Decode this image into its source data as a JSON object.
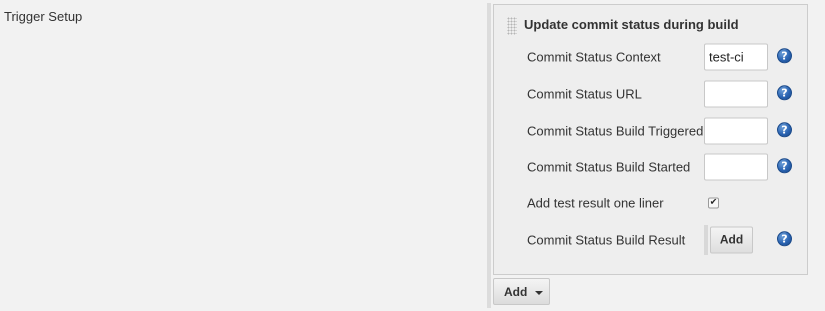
{
  "section": {
    "label": "Trigger Setup"
  },
  "panel": {
    "title": "Update commit status during build",
    "rows": [
      {
        "label": "Commit Status Context",
        "value": "test-ci",
        "help": "?"
      },
      {
        "label": "Commit Status URL",
        "value": "",
        "help": "?"
      },
      {
        "label": "Commit Status Build Triggered",
        "value": "",
        "help": "?"
      },
      {
        "label": "Commit Status Build Started",
        "value": "",
        "help": "?"
      },
      {
        "label": "Add test result one liner",
        "checked": true,
        "check_glyph": "✔"
      },
      {
        "label": "Commit Status Build Result",
        "button": "Add",
        "help": "?"
      }
    ]
  },
  "footer": {
    "add_label": "Add"
  },
  "colors": {
    "page_bg": "#f2f2f2",
    "panel_bg": "#eeeeee",
    "help_icon": "#2a64b3"
  },
  "icons": {
    "help": "help-icon",
    "drag": "drag-handle-icon",
    "dropdown": "chevron-down-icon"
  }
}
